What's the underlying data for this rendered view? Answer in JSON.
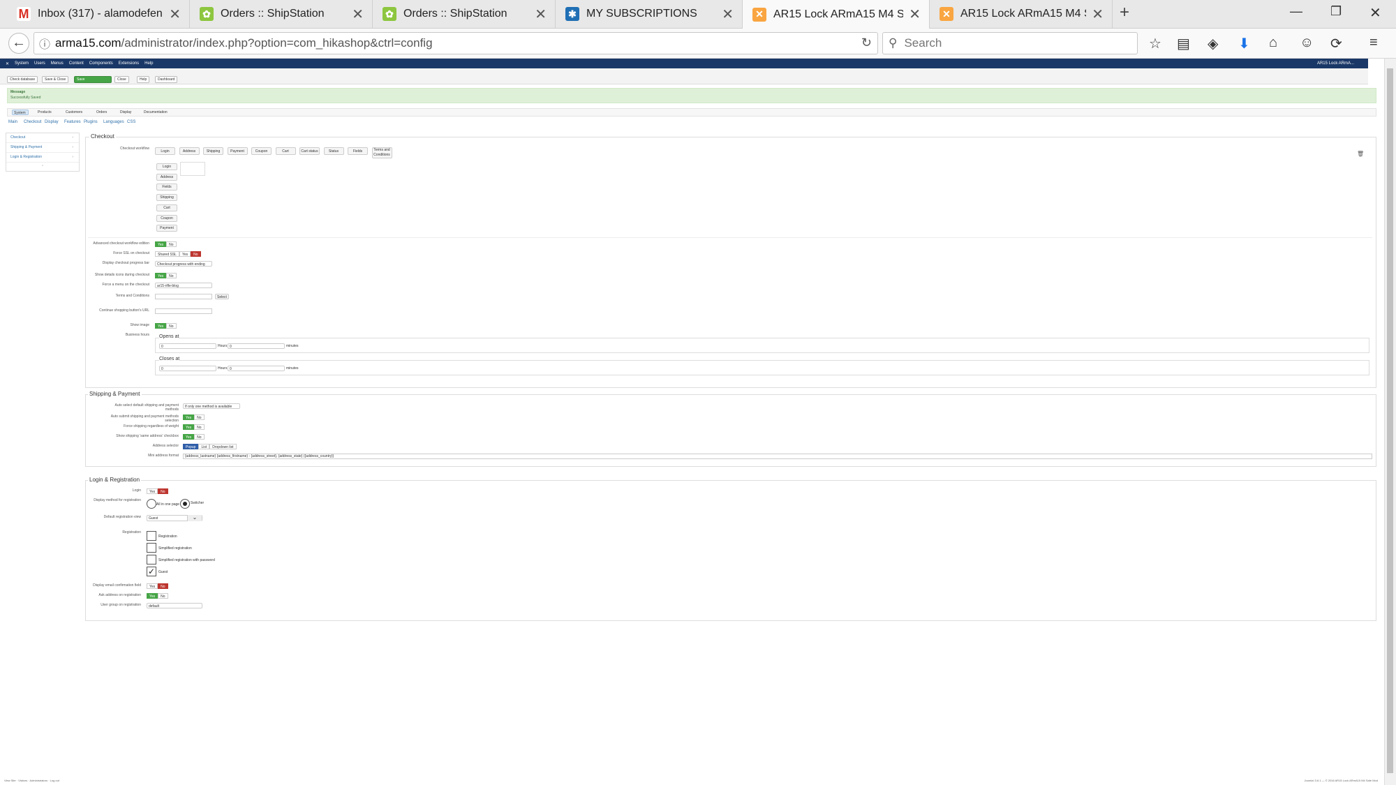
{
  "browser": {
    "tabs": [
      {
        "title": "Inbox (317) - alamodefen…",
        "icon": "gmail-icon",
        "color": "#d93025"
      },
      {
        "title": "Orders :: ShipStation",
        "icon": "shipstation-icon",
        "color": "#8dc63f"
      },
      {
        "title": "Orders :: ShipStation",
        "icon": "shipstation-icon",
        "color": "#8dc63f"
      },
      {
        "title": "MY SUBSCRIPTIONS",
        "icon": "subscriptions-icon",
        "color": "#1f6fb5"
      },
      {
        "title": "AR15 Lock ARmA15 M4 S…",
        "icon": "joomla-icon",
        "color": "#f9a541"
      },
      {
        "title": "AR15 Lock ARmA15 M4 S…",
        "icon": "joomla-icon",
        "color": "#f9a541"
      }
    ],
    "url_host": "arma15.com",
    "url_path": "/administrator/index.php?option=com_hikashop&ctrl=config",
    "search_placeholder": "Search"
  },
  "joomla": {
    "topmenu": [
      "System",
      "Users",
      "Menus",
      "Content",
      "Components",
      "Extensions",
      "Help"
    ],
    "site_link": "AR15 Lock ARmA...",
    "toolbar": [
      "Check database",
      "Save & Close",
      "Save",
      "Close",
      "Help",
      "Dashboard"
    ],
    "message_title": "Message",
    "message_text": "Successfully Saved",
    "hika_menu": [
      "System",
      "Products",
      "Customers",
      "Orders",
      "Display",
      "Documentation"
    ],
    "subtabs": [
      "Main",
      "Checkout",
      "Display",
      "Features",
      "Plugins",
      "Languages",
      "CSS"
    ],
    "sidenav": [
      "Checkout",
      "Shipping & Payment",
      "Login & Registration"
    ],
    "footer": "View Site · Visitors · Administrators · Log out",
    "footer_right": "Joomla! 3.6.1 — © 2016 AR15 Lock ARmA15 M4 Safe Mod"
  },
  "checkout": {
    "legend": "Checkout",
    "workflow_label": "Checkout workflow",
    "workflow_steps": [
      "Login",
      "Address",
      "Shipping",
      "Payment",
      "Coupon",
      "Cart",
      "Cart status",
      "Status",
      "Fields",
      "Terms and Conditions"
    ],
    "workflow_stack": [
      "Login",
      "Address",
      "Fields",
      "Shipping",
      "Cart",
      "Coupon",
      "Payment"
    ],
    "rows": {
      "advanced": "Advanced checkout workflow edition",
      "force_ssl": "Force SSL on checkout",
      "progress_bar": "Display checkout progress bar",
      "progress_value": "Checkout progress with ending",
      "show_details": "Show details icons during checkout",
      "force_menu": "Force a menu on the checkout",
      "force_menu_value": "ar15-rifle-blog",
      "terms": "Terms and Conditions",
      "terms_btn": "Select",
      "continue_url": "Continue shopping button's URL",
      "show_image": "Show image",
      "business_hours": "Business hours",
      "opens_at": "Opens at",
      "closes_at": "Closes at",
      "hours": "Hours",
      "minutes": "minutes",
      "zero": "0",
      "shared_ssl": "Shared SSL",
      "yes": "Yes",
      "no": "No"
    }
  },
  "shipping": {
    "legend": "Shipping & Payment",
    "auto_select": "Auto select default shipping and payment methods",
    "auto_select_value": "If only one method is available",
    "auto_submit": "Auto submit shipping and payment methods selection",
    "force_shipping": "Force shipping regardless of weight",
    "same_address": "Show shipping 'same address' checkbox",
    "address_selector": "Address selector",
    "popup": "Popup",
    "list": "List",
    "dropdown": "Dropdown list",
    "mini_format": "Mini address format",
    "mini_format_value": "{address_lastname} {address_firstname} - {address_street}, {address_state} ({address_country})"
  },
  "login": {
    "legend": "Login & Registration",
    "login": "Login",
    "display_method": "Display method for registration",
    "all_in_one": "All in one page",
    "switcher": "Switcher",
    "default_view": "Default registration view",
    "default_view_value": "Guest",
    "registration": "Registration",
    "reg_options": [
      "Registration",
      "Simplified registration",
      "Simplified registration with password",
      "Guest"
    ],
    "email_confirm": "Display email confirmation field",
    "ask_address": "Ask address on registration",
    "user_group": "User group on registration",
    "user_group_value": "default"
  }
}
